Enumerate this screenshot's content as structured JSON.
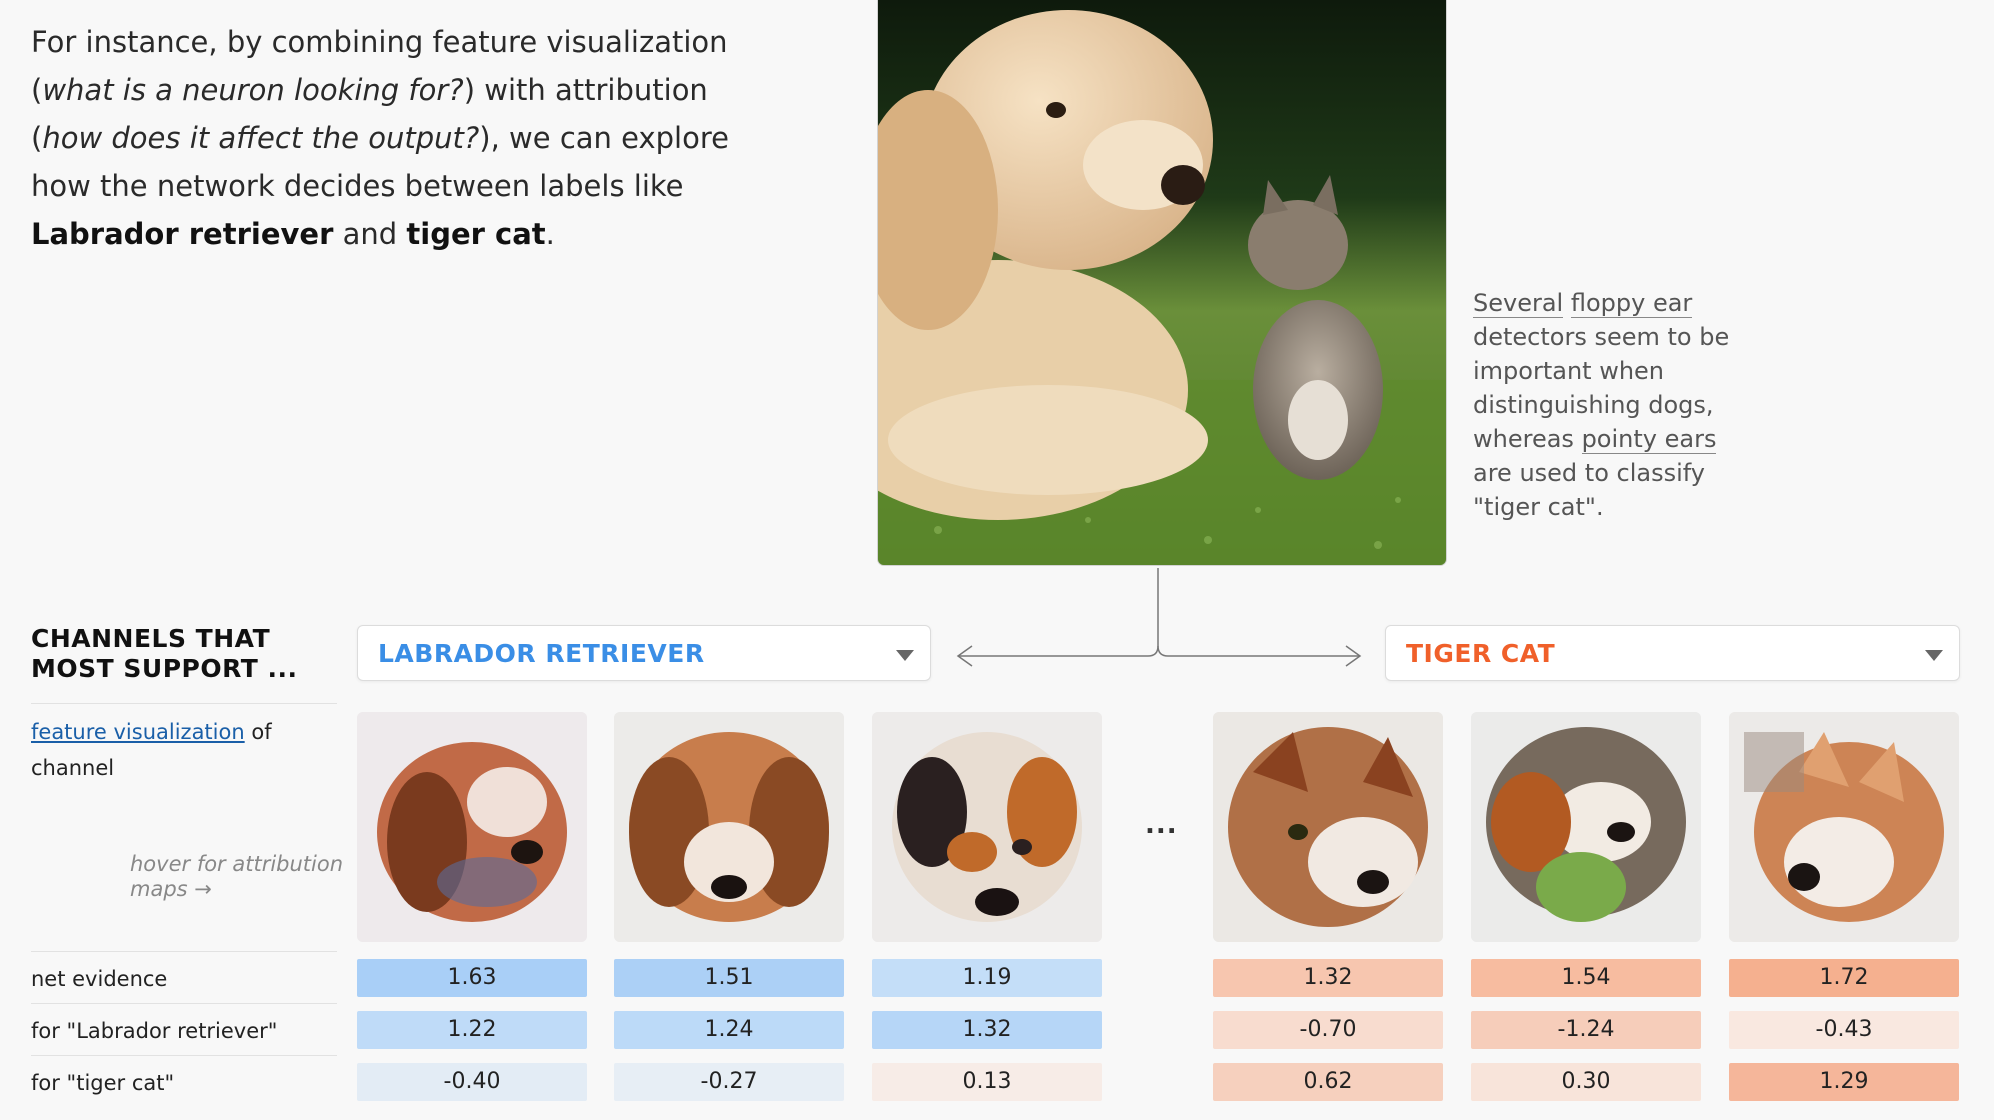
{
  "intro": {
    "t1": "For instance, by combining feature visualization (",
    "q1": "what is a neuron looking for?",
    "t2": ") with attribution (",
    "q2": "how does it affect the output?",
    "t3": "), we can explore how the network decides between labels like ",
    "label_a": "Labrador retriever",
    "t4": " and ",
    "label_b": "tiger cat",
    "t5": "."
  },
  "note": {
    "w1": "Several",
    "w2": "floppy ear",
    "t1": " detectors seem to be important when distinguishing dogs, whereas ",
    "w3": "pointy ears",
    "t2": " are used to classify \"tiger cat\"."
  },
  "channels_title": "CHANNELS THAT MOST SUPPORT ...",
  "dropdowns": {
    "left": "LABRADOR RETRIEVER",
    "right": "TIGER CAT"
  },
  "feature_label": {
    "link": "feature visualization",
    "rest": " of channel"
  },
  "hover_hint": "hover for attribution maps",
  "hover_arrow": "→",
  "ellipsis": "...",
  "rows": {
    "net": "net evidence",
    "lab": "for \"Labrador retriever\"",
    "tig": "for \"tiger cat\""
  },
  "table": {
    "net": [
      "1.63",
      "1.51",
      "1.19",
      "1.32",
      "1.54",
      "1.72"
    ],
    "lab": [
      "1.22",
      "1.24",
      "1.32",
      "-0.70",
      "-1.24",
      "-0.43"
    ],
    "tig": [
      "-0.40",
      "-0.27",
      "0.13",
      "0.62",
      "0.30",
      "1.29"
    ]
  },
  "colors": {
    "blue_accent": "#3a8ee6",
    "orange_accent": "#f0602a",
    "net": [
      "#a9cff7",
      "#acd0f6",
      "#c4def8",
      "#f7c6af",
      "#f7bca0",
      "#f5b08f"
    ],
    "lab": [
      "#bfdbf8",
      "#bcdaf8",
      "#b6d6f7",
      "#f8dccf",
      "#f6cdba",
      "#f9e8e0"
    ],
    "tig": [
      "#e3ecf5",
      "#e7eef5",
      "#f7ece7",
      "#f6d0be",
      "#f8e4da",
      "#f5b69a"
    ]
  }
}
